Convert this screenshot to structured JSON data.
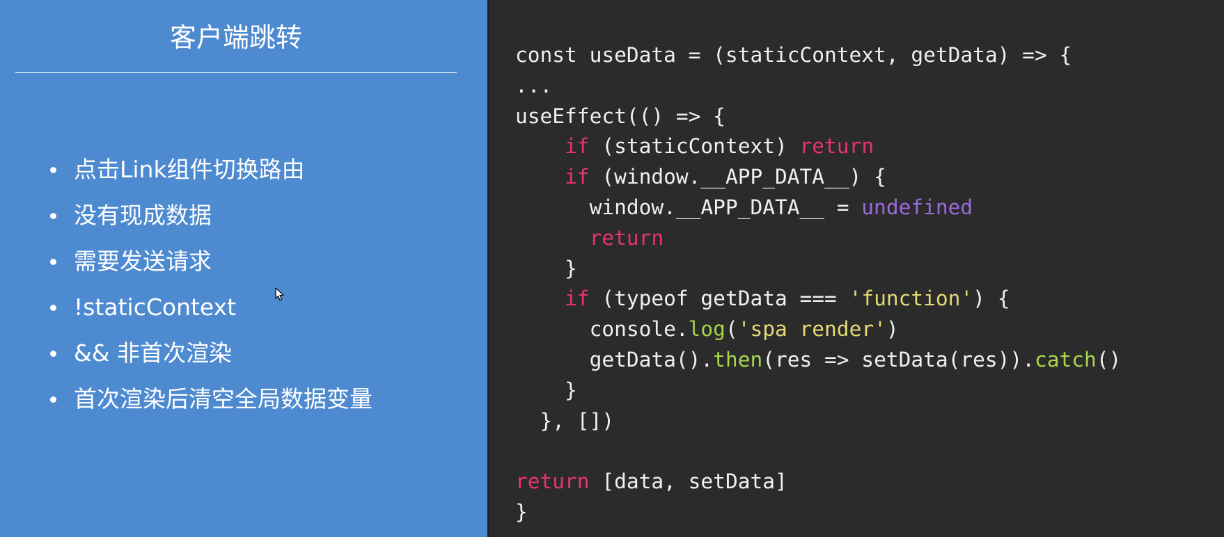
{
  "slide": {
    "title": "客户端跳转",
    "bullets": [
      "点击Link组件切换路由",
      "没有现成数据",
      "需要发送请求",
      "!staticContext",
      "&& 非首次渲染",
      "首次渲染后清空全局数据变量"
    ]
  },
  "code": {
    "lines": [
      [
        {
          "t": "const useData = (staticContext, getData) => {",
          "c": "plain"
        }
      ],
      [
        {
          "t": "...",
          "c": "plain"
        }
      ],
      [
        {
          "t": "useEffect(() => {",
          "c": "plain"
        }
      ],
      [
        {
          "t": "    ",
          "c": "plain"
        },
        {
          "t": "if",
          "c": "kw"
        },
        {
          "t": " (staticContext) ",
          "c": "plain"
        },
        {
          "t": "return",
          "c": "kw"
        }
      ],
      [
        {
          "t": "    ",
          "c": "plain"
        },
        {
          "t": "if",
          "c": "kw"
        },
        {
          "t": " (window.__APP_DATA__) {",
          "c": "plain"
        }
      ],
      [
        {
          "t": "      window.__APP_DATA__ = ",
          "c": "plain"
        },
        {
          "t": "undefined",
          "c": "undef"
        }
      ],
      [
        {
          "t": "      ",
          "c": "plain"
        },
        {
          "t": "return",
          "c": "kw"
        }
      ],
      [
        {
          "t": "    }",
          "c": "plain"
        }
      ],
      [
        {
          "t": "    ",
          "c": "plain"
        },
        {
          "t": "if",
          "c": "kw"
        },
        {
          "t": " (typeof getData === ",
          "c": "plain"
        },
        {
          "t": "'function'",
          "c": "str"
        },
        {
          "t": ") {",
          "c": "plain"
        }
      ],
      [
        {
          "t": "      console.",
          "c": "plain"
        },
        {
          "t": "log",
          "c": "fn"
        },
        {
          "t": "(",
          "c": "plain"
        },
        {
          "t": "'spa render'",
          "c": "str"
        },
        {
          "t": ")",
          "c": "plain"
        }
      ],
      [
        {
          "t": "      getData().",
          "c": "plain"
        },
        {
          "t": "then",
          "c": "fn"
        },
        {
          "t": "(res => setData(res)).",
          "c": "plain"
        },
        {
          "t": "catch",
          "c": "fn"
        },
        {
          "t": "()",
          "c": "plain"
        }
      ],
      [
        {
          "t": "    }",
          "c": "plain"
        }
      ],
      [
        {
          "t": "  }, [])",
          "c": "plain"
        }
      ],
      [
        {
          "t": "",
          "c": "plain"
        }
      ],
      [
        {
          "t": "return",
          "c": "kw"
        },
        {
          "t": " [data, setData]",
          "c": "plain"
        }
      ],
      [
        {
          "t": "}",
          "c": "plain"
        }
      ]
    ]
  },
  "colors": {
    "left_bg": "#4d8ad0",
    "code_bg": "#2b2b2b",
    "keyword": "#e8336f",
    "function": "#a6d64a",
    "string": "#e4db74",
    "undefined": "#9b6bdc"
  },
  "icons": {
    "cursor": "mouse-pointer-icon"
  }
}
